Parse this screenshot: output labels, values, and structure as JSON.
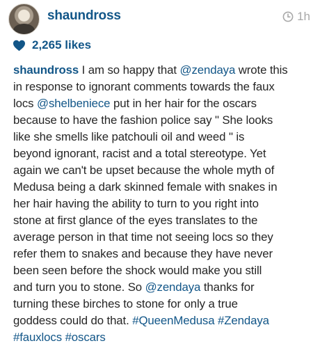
{
  "post": {
    "username": "shaundross",
    "timestamp": "1h",
    "likes": "2,265 likes"
  },
  "icons": {
    "avatar": "profile-avatar",
    "clock": "clock-icon",
    "heart": "heart-icon"
  },
  "colors": {
    "link": "#125688",
    "text": "#262626",
    "muted": "#a8a8a8"
  },
  "caption": {
    "lines": [
      [
        {
          "t": "shaundross",
          "k": "user"
        },
        {
          "t": " I am so happy that ",
          "k": "text"
        },
        {
          "t": "@zendaya",
          "k": "link"
        },
        {
          "t": " wrote this",
          "k": "text"
        }
      ],
      [
        {
          "t": "in response to ignorant comments towards the faux",
          "k": "text"
        }
      ],
      [
        {
          "t": "locs ",
          "k": "text"
        },
        {
          "t": "@shelbeniece",
          "k": "link"
        },
        {
          "t": " put in her hair for the oscars",
          "k": "text"
        }
      ],
      [
        {
          "t": "because to have the fashion police say \" She looks",
          "k": "text"
        }
      ],
      [
        {
          "t": "like she smells like patchouli oil and weed \" is",
          "k": "text"
        }
      ],
      [
        {
          "t": "beyond ignorant, racist and a total stereotype. Yet",
          "k": "text"
        }
      ],
      [
        {
          "t": "again we can't be upset because the whole myth of",
          "k": "text"
        }
      ],
      [
        {
          "t": "Medusa being a dark skinned female with snakes in",
          "k": "text"
        }
      ],
      [
        {
          "t": "her hair having the ability to turn to you right into",
          "k": "text"
        }
      ],
      [
        {
          "t": "stone at first glance of the eyes translates to the",
          "k": "text"
        }
      ],
      [
        {
          "t": "average person in that time not seeing locs so they",
          "k": "text"
        }
      ],
      [
        {
          "t": "refer them to snakes and because they have never",
          "k": "text"
        }
      ],
      [
        {
          "t": "been seen before the shock would make you still",
          "k": "text"
        }
      ],
      [
        {
          "t": "and turn you to stone. So ",
          "k": "text"
        },
        {
          "t": "@zendaya",
          "k": "link"
        },
        {
          "t": " thanks for",
          "k": "text"
        }
      ],
      [
        {
          "t": "turning these birches to stone for only a true",
          "k": "text"
        }
      ],
      [
        {
          "t": "goddess could do that. ",
          "k": "text"
        },
        {
          "t": "#QueenMedusa",
          "k": "link"
        },
        {
          "t": " ",
          "k": "text"
        },
        {
          "t": "#Zendaya",
          "k": "link"
        }
      ],
      [
        {
          "t": "#fauxlocs",
          "k": "link"
        },
        {
          "t": " ",
          "k": "text"
        },
        {
          "t": "#oscars",
          "k": "link"
        }
      ]
    ]
  }
}
